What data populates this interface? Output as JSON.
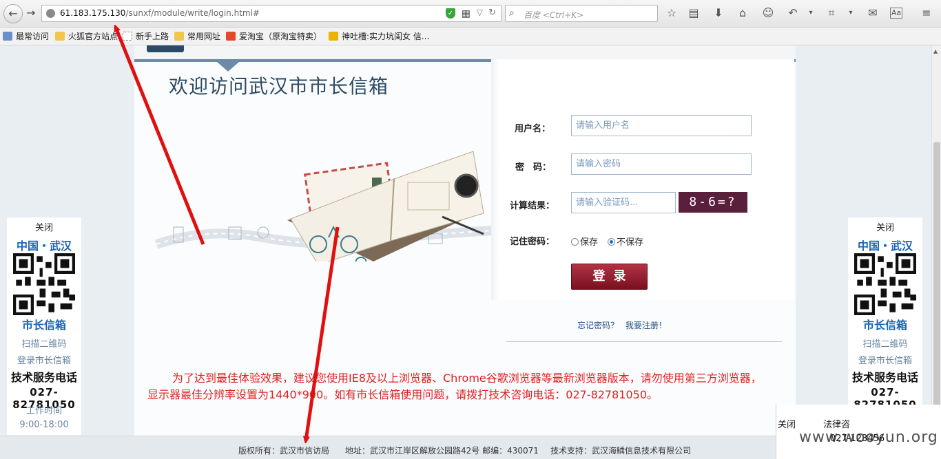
{
  "browser": {
    "url_host": "61.183.175.130",
    "url_path": "/sunxf/module/write/login.html#",
    "search_placeholder": "百度 <Ctrl+K>"
  },
  "bookmarks": [
    {
      "label": "最常访问"
    },
    {
      "label": "火狐官方站点"
    },
    {
      "label": "新手上路"
    },
    {
      "label": "常用网址"
    },
    {
      "label": "爱淘宝（原淘宝特卖）"
    },
    {
      "label": "神吐槽:实力坑闺女 信..."
    }
  ],
  "welcome": "欢迎访问武汉市市长信箱",
  "login": {
    "username_label": "用户名：",
    "username_placeholder": "请输入用户名",
    "password_label": "密　码：",
    "password_placeholder": "请输入密码",
    "captcha_label": "计算结果：",
    "captcha_placeholder": "请输入验证码...",
    "captcha_text": "8-6=?",
    "remember_label": "记住密码：",
    "remember_yes": "保存",
    "remember_no": "不保存",
    "submit": "登录",
    "forgot": "忘记密码？",
    "register": "我要注册！"
  },
  "notice": "为了达到最佳体验效果，建议您使用IE8及以上浏览器、Chrome谷歌浏览器等最新浏览器版本，请勿使用第三方浏览器， 显示器最佳分辨率设置为1440*900。如有市长信箱使用问题，请拨打技术咨询电话：027-82781050。",
  "footer": {
    "copyright": "版权所有：武汉市信访局",
    "address": "地址：武汉市江岸区解放公园路42号 邮编：430071",
    "support": "技术支持：武汉海鳞信息技术有限公司"
  },
  "float_box": {
    "close": "关闭",
    "city": "中国・武汉",
    "title": "市长信箱",
    "scan": "扫描二维码",
    "login": "登录市长信箱",
    "tech": "技术服务电话",
    "phone": "027-82781050",
    "time_label": "工作时间",
    "hours": "9:00-18:00"
  },
  "popup": {
    "close": "关闭",
    "legal": "法律咨",
    "phone": "027-123456"
  },
  "watermark": "www.wooyun.org"
}
